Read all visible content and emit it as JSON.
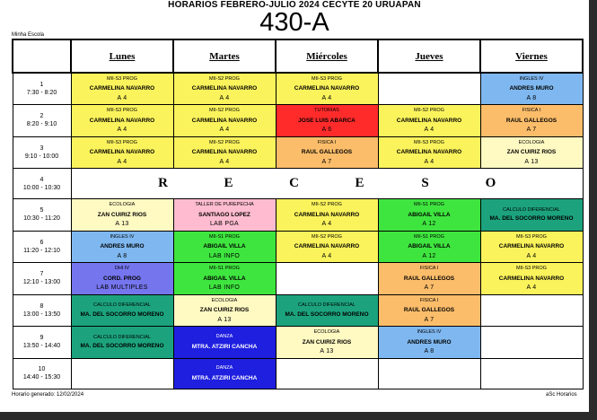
{
  "header": {
    "title": "HORARIOS FEBRERO-JULIO  2024  CECYTE 20 URUAPAN",
    "group": "430-A",
    "school": "Minha Escola"
  },
  "footer": {
    "generated": "Horario generado: 12/02/2024",
    "software": "aSc Horarios"
  },
  "days": [
    "Lunes",
    "Martes",
    "Miércoles",
    "Jueves",
    "Viernes"
  ],
  "periods": [
    {
      "num": "1",
      "time": "7:30 - 8:20"
    },
    {
      "num": "2",
      "time": "8:20 - 9:10"
    },
    {
      "num": "3",
      "time": "9:10 - 10:00"
    },
    {
      "num": "4",
      "time": "10:00 - 10:30"
    },
    {
      "num": "5",
      "time": "10:30 - 11:20"
    },
    {
      "num": "6",
      "time": "11:20 - 12:10"
    },
    {
      "num": "7",
      "time": "12:10 - 13:00"
    },
    {
      "num": "8",
      "time": "13:00 - 13:50"
    },
    {
      "num": "9",
      "time": "13:50 - 14:40"
    },
    {
      "num": "10",
      "time": "14:40 - 15:30"
    }
  ],
  "receso_letters": [
    "R",
    "E",
    "C",
    "E",
    "S",
    "O"
  ],
  "colors": {
    "yellow": "#fbf35c",
    "sky": "#7fb8f0",
    "red": "#ff2b2b",
    "orange": "#fbbd6a",
    "lightyellow": "#fff9c2",
    "teal": "#1ca37d",
    "pink": "#ffbcd0",
    "green": "#3fe53f",
    "violet": "#7575ee",
    "blue": "#1f1fe0"
  },
  "schedule": [
    [
      {
        "subject": "MII-S3 PROG",
        "teacher": "CARMELINA NAVARRO",
        "room": "A 4",
        "color": "yellow"
      },
      {
        "subject": "MII-S2 PROG",
        "teacher": "CARMELINA NAVARRO",
        "room": "A 4",
        "color": "yellow"
      },
      {
        "subject": "MII-S3 PROG",
        "teacher": "CARMELINA NAVARRO",
        "room": "A 4",
        "color": "yellow"
      },
      null,
      {
        "subject": "INGLES IV",
        "teacher": "ANDRES MURO",
        "room": "A 8",
        "color": "sky"
      }
    ],
    [
      {
        "subject": "MII-S3 PROG",
        "teacher": "CARMELINA NAVARRO",
        "room": "A 4",
        "color": "yellow"
      },
      {
        "subject": "MII-S2 PROG",
        "teacher": "CARMELINA NAVARRO",
        "room": "A 4",
        "color": "yellow"
      },
      {
        "subject": "TUTORIAS",
        "teacher": "JOSE LUIS ABARCA",
        "room": "A 6",
        "color": "red"
      },
      {
        "subject": "MII-S2 PROG",
        "teacher": "CARMELINA NAVARRO",
        "room": "A 4",
        "color": "yellow"
      },
      {
        "subject": "FISICA I",
        "teacher": "RAUL GALLEGOS",
        "room": "A 7",
        "color": "orange"
      }
    ],
    [
      {
        "subject": "MII-S3 PROG",
        "teacher": "CARMELINA NAVARRO",
        "room": "A 4",
        "color": "yellow"
      },
      {
        "subject": "MII-S2 PROG",
        "teacher": "CARMELINA NAVARRO",
        "room": "A 4",
        "color": "yellow"
      },
      {
        "subject": "FISICA I",
        "teacher": "RAUL GALLEGOS",
        "room": "A 7",
        "color": "orange"
      },
      {
        "subject": "MII-S3 PROG",
        "teacher": "CARMELINA NAVARRO",
        "room": "A 4",
        "color": "yellow"
      },
      {
        "subject": "ECOLOGIA",
        "teacher": "ZAN CUIRIZ RIOS",
        "room": "A 13",
        "color": "lightyellow"
      }
    ],
    "RECESO",
    [
      {
        "subject": "ECOLOGIA",
        "teacher": "ZAN CUIRIZ RIOS",
        "room": "A 13",
        "color": "lightyellow"
      },
      {
        "subject": "TALLER DE PUREPECHA",
        "teacher": "SANTIAGO LOPEZ",
        "room": "LAB PGA",
        "color": "pink"
      },
      {
        "subject": "MII-S2 PROG",
        "teacher": "CARMELINA NAVARRO",
        "room": "A 4",
        "color": "yellow"
      },
      {
        "subject": "MII-S1 PROG",
        "teacher": "ABIGAIL VILLA",
        "room": "A 12",
        "color": "green"
      },
      {
        "subject": "CALCULO DIFERENCIAL",
        "teacher": "MA. DEL SOCORRO MORENO",
        "room": "",
        "color": "teal"
      }
    ],
    [
      {
        "subject": "INGLES IV",
        "teacher": "ANDRES MURO",
        "room": "A 8",
        "color": "sky"
      },
      {
        "subject": "MII-S1 PROG",
        "teacher": "ABIGAIL VILLA",
        "room": "LAB INFO",
        "color": "green"
      },
      {
        "subject": "MII-S2 PROG",
        "teacher": "CARMELINA NAVARRO",
        "room": "A 4",
        "color": "yellow"
      },
      {
        "subject": "MII-S1 PROG",
        "teacher": "ABIGAIL VILLA",
        "room": "A 12",
        "color": "green"
      },
      {
        "subject": "MII-S3 PROG",
        "teacher": "CARMELINA NAVARRO",
        "room": "A 4",
        "color": "yellow"
      }
    ],
    [
      {
        "subject": "DHI IV",
        "teacher": "CORD. PROG",
        "room": "LAB MULTIPLES",
        "color": "violet"
      },
      {
        "subject": "MII-S1 PROG",
        "teacher": "ABIGAIL VILLA",
        "room": "LAB INFO",
        "color": "green"
      },
      null,
      {
        "subject": "FISICA I",
        "teacher": "RAUL GALLEGOS",
        "room": "A 7",
        "color": "orange"
      },
      {
        "subject": "MII-S3 PROG",
        "teacher": "CARMELINA NAVARRO",
        "room": "A 4",
        "color": "yellow"
      }
    ],
    [
      {
        "subject": "CALCULO DIFERENCIAL",
        "teacher": "MA. DEL SOCORRO MORENO",
        "room": "",
        "color": "teal"
      },
      {
        "subject": "ECOLOGIA",
        "teacher": "ZAN CUIRIZ RIOS",
        "room": "A 13",
        "color": "lightyellow"
      },
      {
        "subject": "CALCULO DIFERENCIAL",
        "teacher": "MA. DEL SOCORRO MORENO",
        "room": "",
        "color": "teal"
      },
      {
        "subject": "FISICA I",
        "teacher": "RAUL GALLEGOS",
        "room": "A 7",
        "color": "orange"
      },
      null
    ],
    [
      {
        "subject": "CALCULO DIFERENCIAL",
        "teacher": "MA. DEL SOCORRO MORENO",
        "room": "",
        "color": "teal"
      },
      {
        "subject": "DANZA",
        "teacher": "MTRA. ATZIRI CANCHA",
        "room": "",
        "color": "blue"
      },
      {
        "subject": "ECOLOGIA",
        "teacher": "ZAN CUIRIZ RIOS",
        "room": "A 13",
        "color": "lightyellow"
      },
      {
        "subject": "INGLES IV",
        "teacher": "ANDRES MURO",
        "room": "A 8",
        "color": "sky"
      },
      null
    ],
    [
      null,
      {
        "subject": "DANZA",
        "teacher": "MTRA. ATZIRI CANCHA",
        "room": "",
        "color": "blue"
      },
      null,
      null,
      null
    ]
  ]
}
